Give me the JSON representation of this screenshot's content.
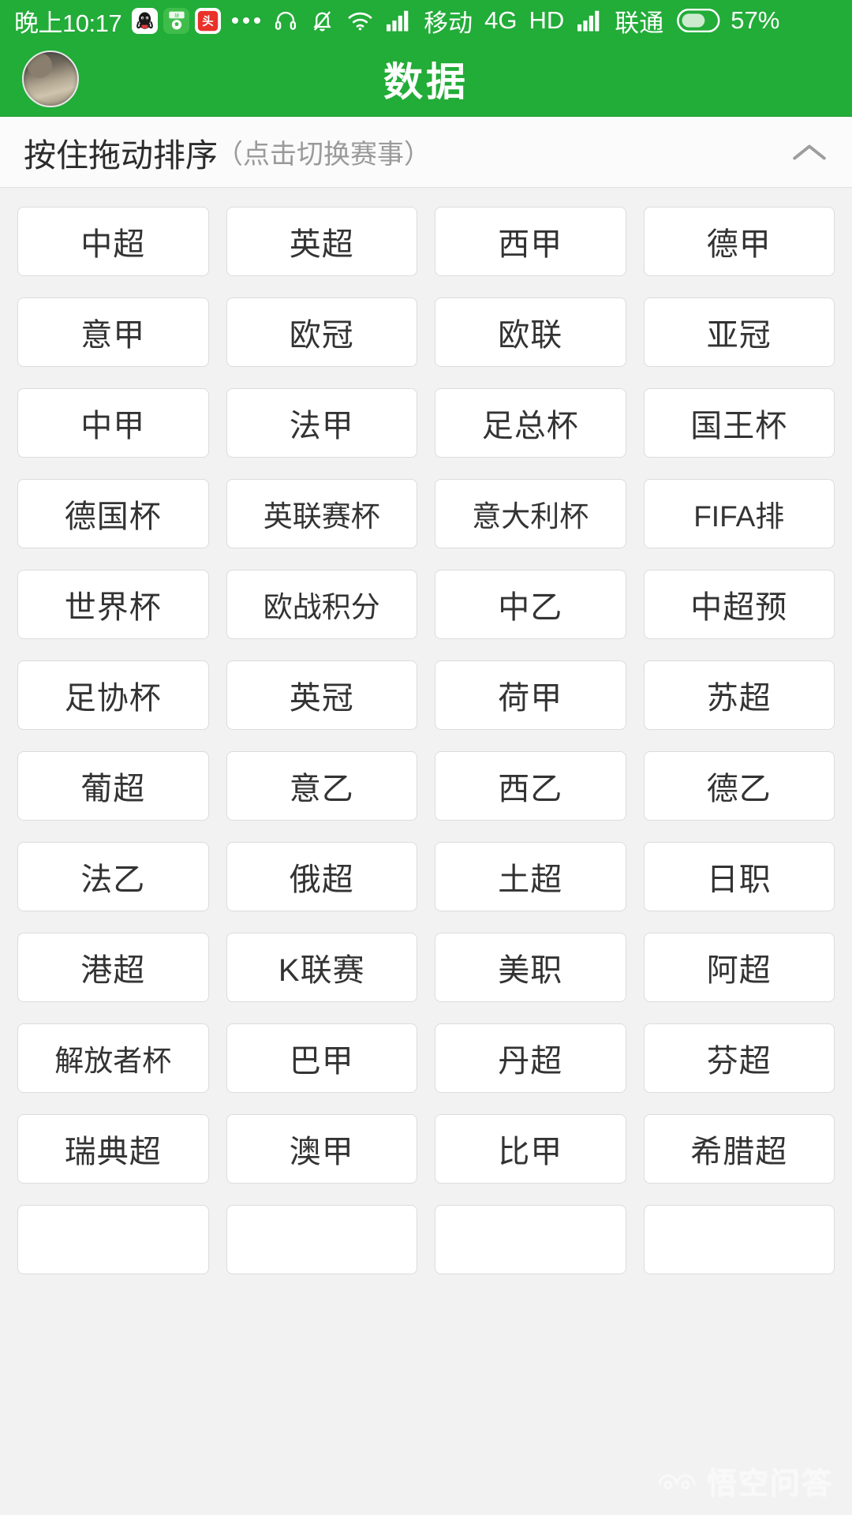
{
  "status_bar": {
    "time": "晚上10:17",
    "app_icons": [
      "qq-icon",
      "soccer-app-icon",
      "toutiao-icon"
    ],
    "overflow": "more-apps-dots",
    "icons": [
      "headphone-icon",
      "bell-muted-icon",
      "wifi-icon",
      "signal-bars-icon"
    ],
    "carrier1": "移动",
    "network": "4G",
    "hd": "HD",
    "carrier2": "联通",
    "battery_percent": "57%",
    "battery_level": 57,
    "background_color": "#22ac38",
    "text_color": "#ffffff"
  },
  "header": {
    "title": "数据",
    "avatar": "user-avatar",
    "background_color": "#22ac38"
  },
  "section": {
    "label": "按住拖动排序",
    "hint": "（点击切换赛事）",
    "chevron": "chevron-up-icon"
  },
  "grid": {
    "columns": 4,
    "leagues": [
      "中超",
      "英超",
      "西甲",
      "德甲",
      "意甲",
      "欧冠",
      "欧联",
      "亚冠",
      "中甲",
      "法甲",
      "足总杯",
      "国王杯",
      "德国杯",
      "英联赛杯",
      "意大利杯",
      "FIFA排",
      "世界杯",
      "欧战积分",
      "中乙",
      "中超预",
      "足协杯",
      "英冠",
      "荷甲",
      "苏超",
      "葡超",
      "意乙",
      "西乙",
      "德乙",
      "法乙",
      "俄超",
      "土超",
      "日职",
      "港超",
      "K联赛",
      "美职",
      "阿超",
      "解放者杯",
      "巴甲",
      "丹超",
      "芬超",
      "瑞典超",
      "澳甲",
      "比甲",
      "希腊超",
      "",
      "",
      "",
      ""
    ]
  },
  "watermark": {
    "text": "悟空问答",
    "logo": "wukong-logo"
  }
}
